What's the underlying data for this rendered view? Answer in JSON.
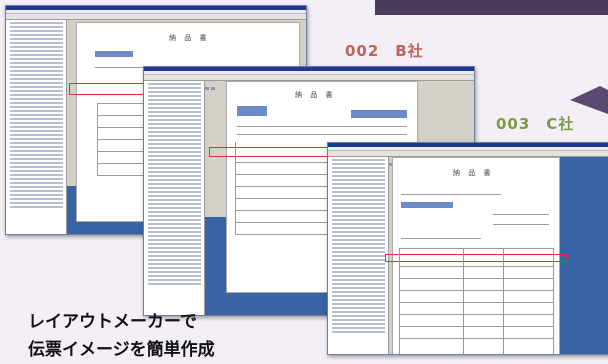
{
  "labels": {
    "company_b": "002　B社",
    "company_c": "003　C社"
  },
  "slip_title": "納 品 書",
  "caption": {
    "line1": "レイアウトメーカーで",
    "line2": "伝票イメージを簡単作成"
  },
  "colors": {
    "band": "#4a3a5e",
    "company_b": "#c0645a",
    "company_c": "#7f9a45",
    "app_blue": "#3863a5"
  }
}
